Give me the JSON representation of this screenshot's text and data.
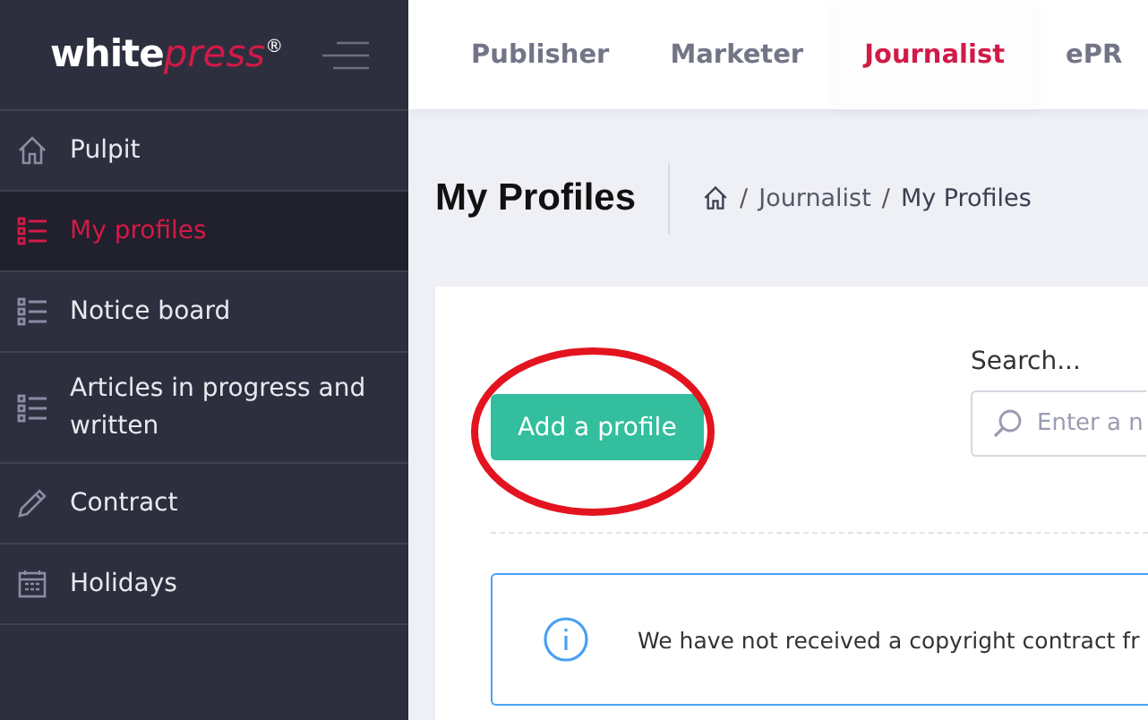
{
  "logo": {
    "word": "white",
    "accent": "press",
    "mark": "®"
  },
  "sidebar": {
    "items": [
      {
        "label": "Pulpit",
        "kind": "home",
        "selected": false
      },
      {
        "label": "My profiles",
        "kind": "list",
        "selected": true
      },
      {
        "label": "Notice board",
        "kind": "list",
        "selected": false
      },
      {
        "label": "Articles in progress and written",
        "kind": "list",
        "selected": false
      },
      {
        "label": "Contract",
        "kind": "pencil",
        "selected": false
      },
      {
        "label": "Holidays",
        "kind": "calendar",
        "selected": false
      }
    ]
  },
  "tabs": [
    {
      "label": "Publisher",
      "selected": false
    },
    {
      "label": "Marketer",
      "selected": false
    },
    {
      "label": "Journalist",
      "selected": true
    },
    {
      "label": "ePR",
      "selected": false
    }
  ],
  "page_title": "My Profiles",
  "breadcrumb": [
    {
      "separator": "/",
      "label": "Journalist"
    },
    {
      "separator": "/",
      "label": "My Profiles"
    }
  ],
  "add_button": "Add a profile",
  "search": {
    "label": "Search...",
    "placeholder": "Enter a n"
  },
  "notice": "We have not received a copyright contract fr"
}
